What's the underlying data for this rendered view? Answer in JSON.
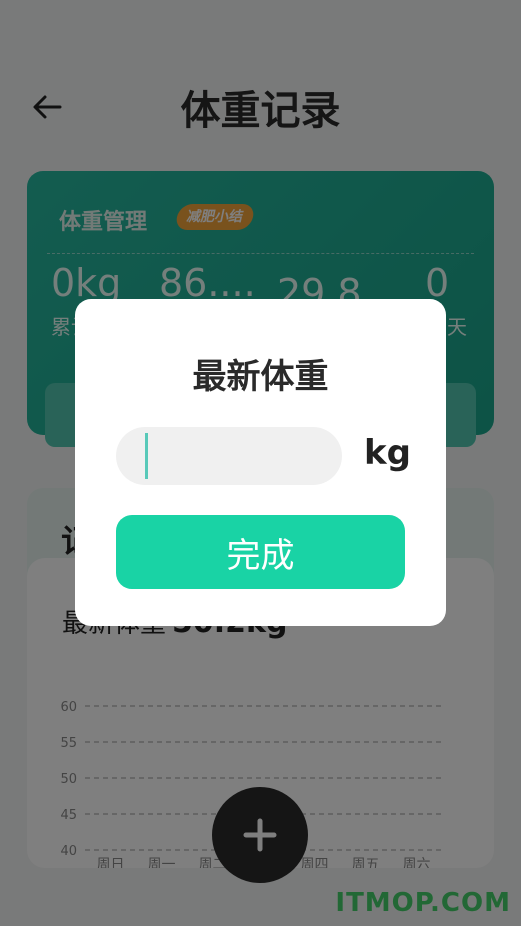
{
  "header": {
    "title": "体重记录"
  },
  "summary_card": {
    "title": "体重管理",
    "badge": "减肥小结",
    "stats": [
      {
        "value": "0kg",
        "label": "累计减重"
      },
      {
        "value": "86....",
        "label": ""
      },
      {
        "value": "29.8",
        "label": ""
      },
      {
        "value": "0",
        "label": "天"
      }
    ]
  },
  "section": {
    "title": "记"
  },
  "chart_card": {
    "latest_label": "最新体重",
    "latest_value": "50.2kg"
  },
  "chart_data": {
    "type": "line",
    "categories": [
      "周日",
      "周一",
      "周二",
      "周三",
      "周四",
      "周五",
      "周六"
    ],
    "yticks": [
      60,
      55,
      50,
      45,
      40
    ],
    "ylim": [
      40,
      60
    ],
    "grid": true,
    "series": []
  },
  "dialog": {
    "title": "最新体重",
    "input_value": "",
    "unit": "kg",
    "done_label": "完成"
  },
  "watermark": "ITMOP.COM",
  "colors": {
    "teal_card": "#1aa68c",
    "done_button": "#19d3a5",
    "badge": "#f2a53a",
    "fab": "#2b2b2b"
  }
}
